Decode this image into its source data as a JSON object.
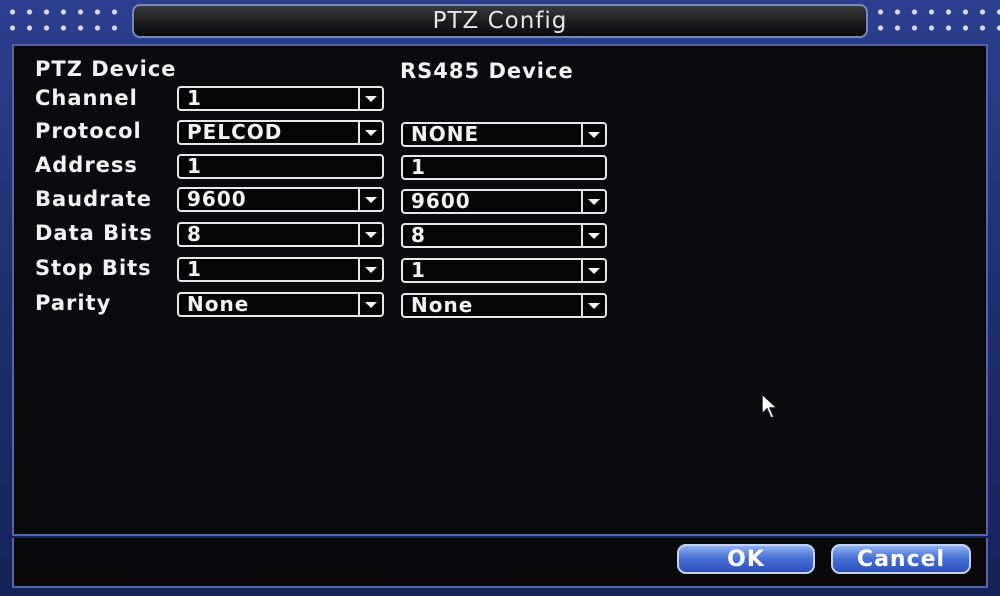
{
  "window": {
    "title": "PTZ Config"
  },
  "sections": {
    "ptz_header": "PTZ Device",
    "rs485_header": "RS485 Device"
  },
  "labels": {
    "channel": "Channel",
    "protocol": "Protocol",
    "address": "Address",
    "baudrate": "Baudrate",
    "data_bits": "Data Bits",
    "stop_bits": "Stop Bits",
    "parity": "Parity"
  },
  "ptz": {
    "channel": "1",
    "protocol": "PELCOD",
    "address": "1",
    "baudrate": "9600",
    "data_bits": "8",
    "stop_bits": "1",
    "parity": "None"
  },
  "rs485": {
    "protocol": "NONE",
    "address": "1",
    "baudrate": "9600",
    "data_bits": "8",
    "stop_bits": "1",
    "parity": "None"
  },
  "buttons": {
    "ok": "OK",
    "cancel": "Cancel"
  },
  "colors": {
    "accent": "#4a74d8",
    "background": "#0b0b0e",
    "frame": "#1f2e6e"
  }
}
